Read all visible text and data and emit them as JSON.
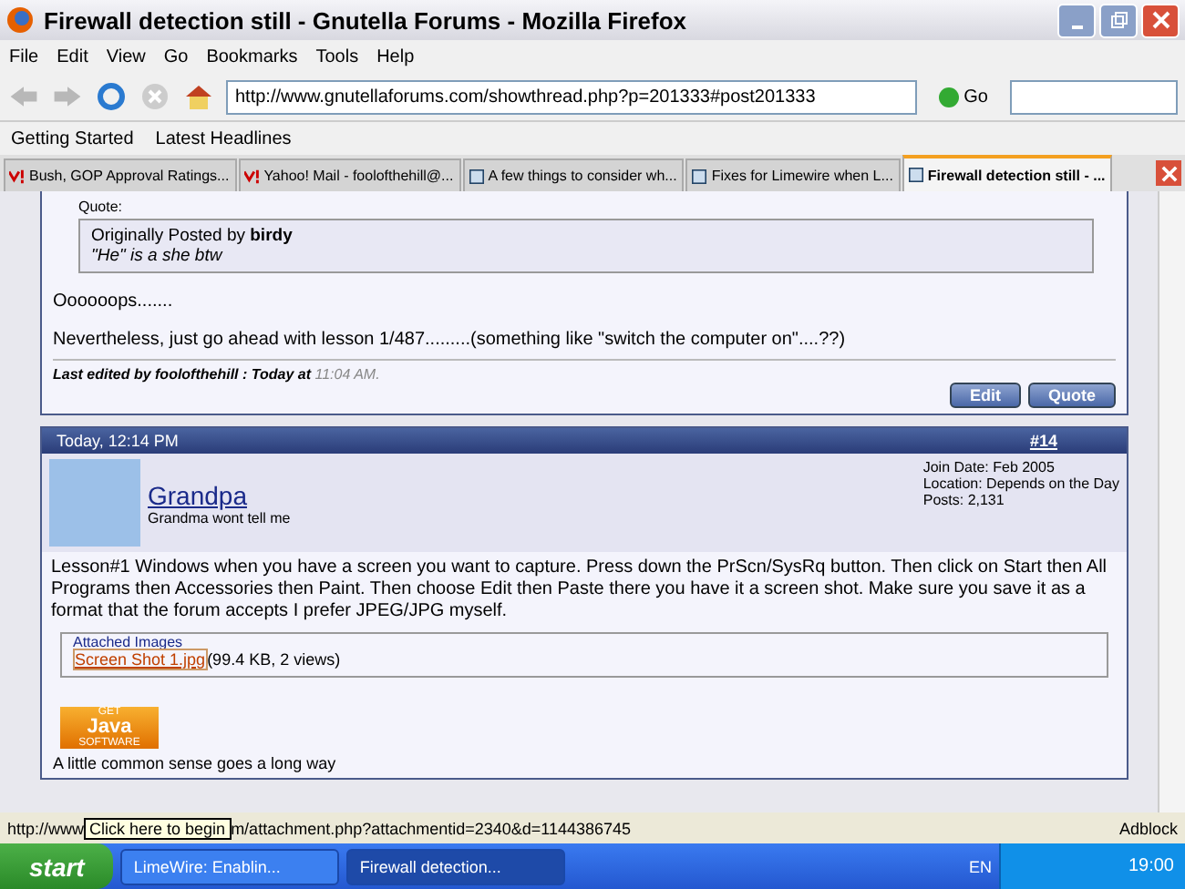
{
  "window": {
    "title": "Firewall detection still - Gnutella Forums - Mozilla Firefox"
  },
  "menu": [
    "File",
    "Edit",
    "View",
    "Go",
    "Bookmarks",
    "Tools",
    "Help"
  ],
  "address": {
    "value": "http://www.gnutellaforums.com/showthread.php?p=201333#post201333",
    "go": "Go"
  },
  "bookmarks": [
    "Getting Started",
    "Latest Headlines"
  ],
  "tabs": [
    {
      "label": "Bush, GOP Approval Ratings...",
      "kind": "yahoo",
      "selected": false
    },
    {
      "label": "Yahoo! Mail - foolofthehill@...",
      "kind": "yahoo",
      "selected": false
    },
    {
      "label": "A few things to consider wh...",
      "kind": "forum",
      "selected": false
    },
    {
      "label": "Fixes for Limewire when L...",
      "kind": "forum",
      "selected": false
    },
    {
      "label": "Firewall detection still - ...",
      "kind": "forum",
      "selected": true
    }
  ],
  "prev_post": {
    "quote_label": "Quote:",
    "quote_by": "Originally Posted by **birdy**",
    "quote_text": "*\"He\" is a she btw*",
    "line1": "Oooooops.......",
    "line2": "Nevertheless, just go ahead with lesson 1/487.........(something like \"switch the computer on\"....??)",
    "edited_by": "Last edited by foolofthehill : Today at",
    "edited_time": "11:04 AM.",
    "buttons": [
      "Edit",
      "Quote"
    ]
  },
  "post": {
    "date": "Today, 12:14 PM",
    "number": "#14",
    "user": "Grandpa",
    "user_title": "Grandma wont tell me",
    "info": [
      "Join Date: Feb 2005",
      "Location: Depends on the Day",
      "Posts: 2,131"
    ],
    "body": "Lesson#1 Windows when you have a screen you want to capture. Press down the PrScn/SysRq button. Then click on Start then All Programs then Accessories then Paint. Then choose Edit then Paste there you have it a screen shot. Make sure you save it as a format that the forum accepts I prefer JPEG/JPG myself.",
    "attach_legend": "Attached Images",
    "attach_link": "Screen Shot 1.jpg",
    "attach_info": "(99.4 KB, 2 views)",
    "java": [
      "GET",
      "Java",
      "SOFTWARE"
    ],
    "signature": "A little common sense goes a long way"
  },
  "status_bar": {
    "url_start": "http://www",
    "tooltip": "Click here to begin",
    "url_end": "m/attachment.php?attachmentid=2340&d=1144386745",
    "adblock": "Adblock"
  },
  "taskbar": {
    "start": "start",
    "tasks": [
      {
        "label": "LimeWire: Enablin...",
        "selected": false
      },
      {
        "label": "Firewall detection...",
        "selected": true
      }
    ],
    "lang": "EN",
    "clock": "19:00"
  }
}
